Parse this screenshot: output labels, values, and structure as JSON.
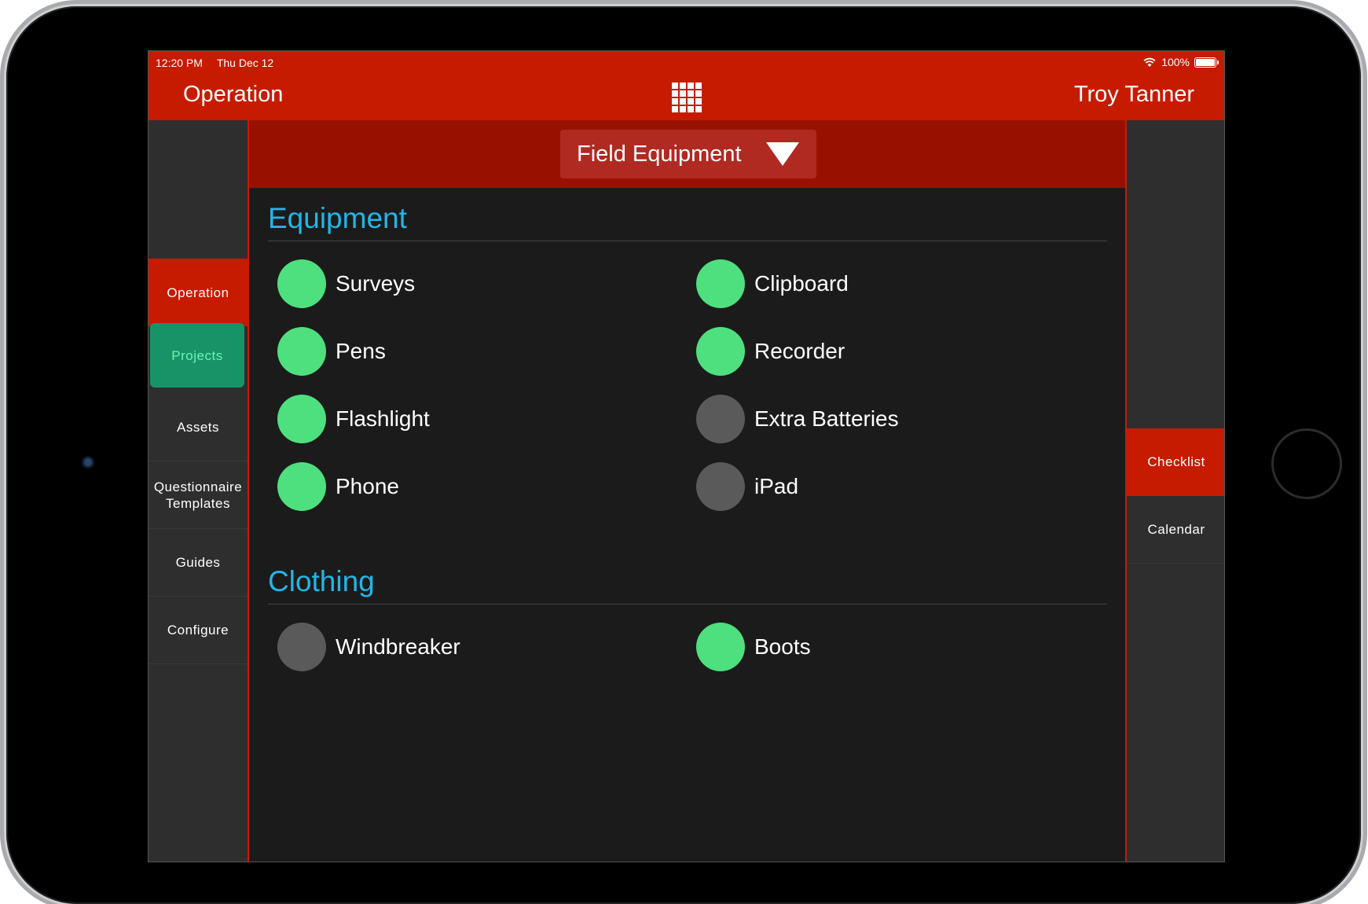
{
  "status_bar": {
    "time": "12:20 PM",
    "date": "Thu Dec 12",
    "battery": "100%"
  },
  "nav": {
    "title": "Operation",
    "user": "Troy Tanner",
    "menu_icon": "grid-icon"
  },
  "left_nav": [
    {
      "label": "Operation",
      "state": "active"
    },
    {
      "label": "Projects",
      "state": "selected"
    },
    {
      "label": "Assets"
    },
    {
      "label": "Questionnaire Templates"
    },
    {
      "label": "Guides"
    },
    {
      "label": "Configure"
    }
  ],
  "right_nav": [
    {
      "label": "Checklist",
      "state": "active"
    },
    {
      "label": "Calendar"
    }
  ],
  "dropdown": {
    "label": "Field Equipment"
  },
  "sections": [
    {
      "title": "Equipment",
      "items": [
        {
          "label": "Surveys",
          "checked": true
        },
        {
          "label": "Clipboard",
          "checked": true
        },
        {
          "label": "Pens",
          "checked": true
        },
        {
          "label": "Recorder",
          "checked": true
        },
        {
          "label": "Flashlight",
          "checked": true
        },
        {
          "label": "Extra Batteries",
          "checked": false
        },
        {
          "label": "Phone",
          "checked": true
        },
        {
          "label": "iPad",
          "checked": false
        }
      ]
    },
    {
      "title": "Clothing",
      "items": [
        {
          "label": "Windbreaker",
          "checked": false
        },
        {
          "label": "Boots",
          "checked": true
        }
      ]
    }
  ],
  "colors": {
    "brand_red": "#c71b00",
    "header_dark_red": "#981100",
    "accent_blue": "#23b6e6",
    "checked_green": "#4ee07e",
    "unchecked_gray": "#5a5a5a",
    "selected_green": "#169468"
  }
}
